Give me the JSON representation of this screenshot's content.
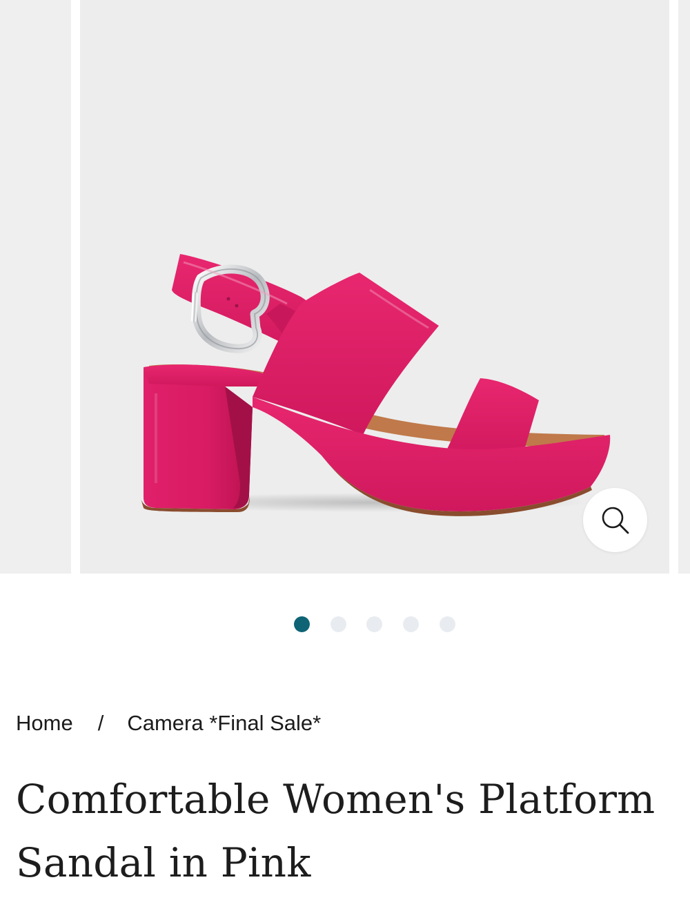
{
  "gallery": {
    "product_image_alt": "Comfortable Women's Platform Sandal in Pink",
    "zoom_icon": "search-icon",
    "slide_count": 5,
    "active_slide": 1
  },
  "breadcrumb": {
    "items": [
      "Home",
      "Camera *Final Sale*"
    ],
    "separator": "/"
  },
  "product": {
    "title": "Comfortable Women's Platform Sandal in Pink"
  },
  "colors": {
    "accent": "#0e6475",
    "dot_inactive": "#e8ecf0",
    "sandal_pink": "#e21d6b",
    "background_gray": "#ededed"
  }
}
